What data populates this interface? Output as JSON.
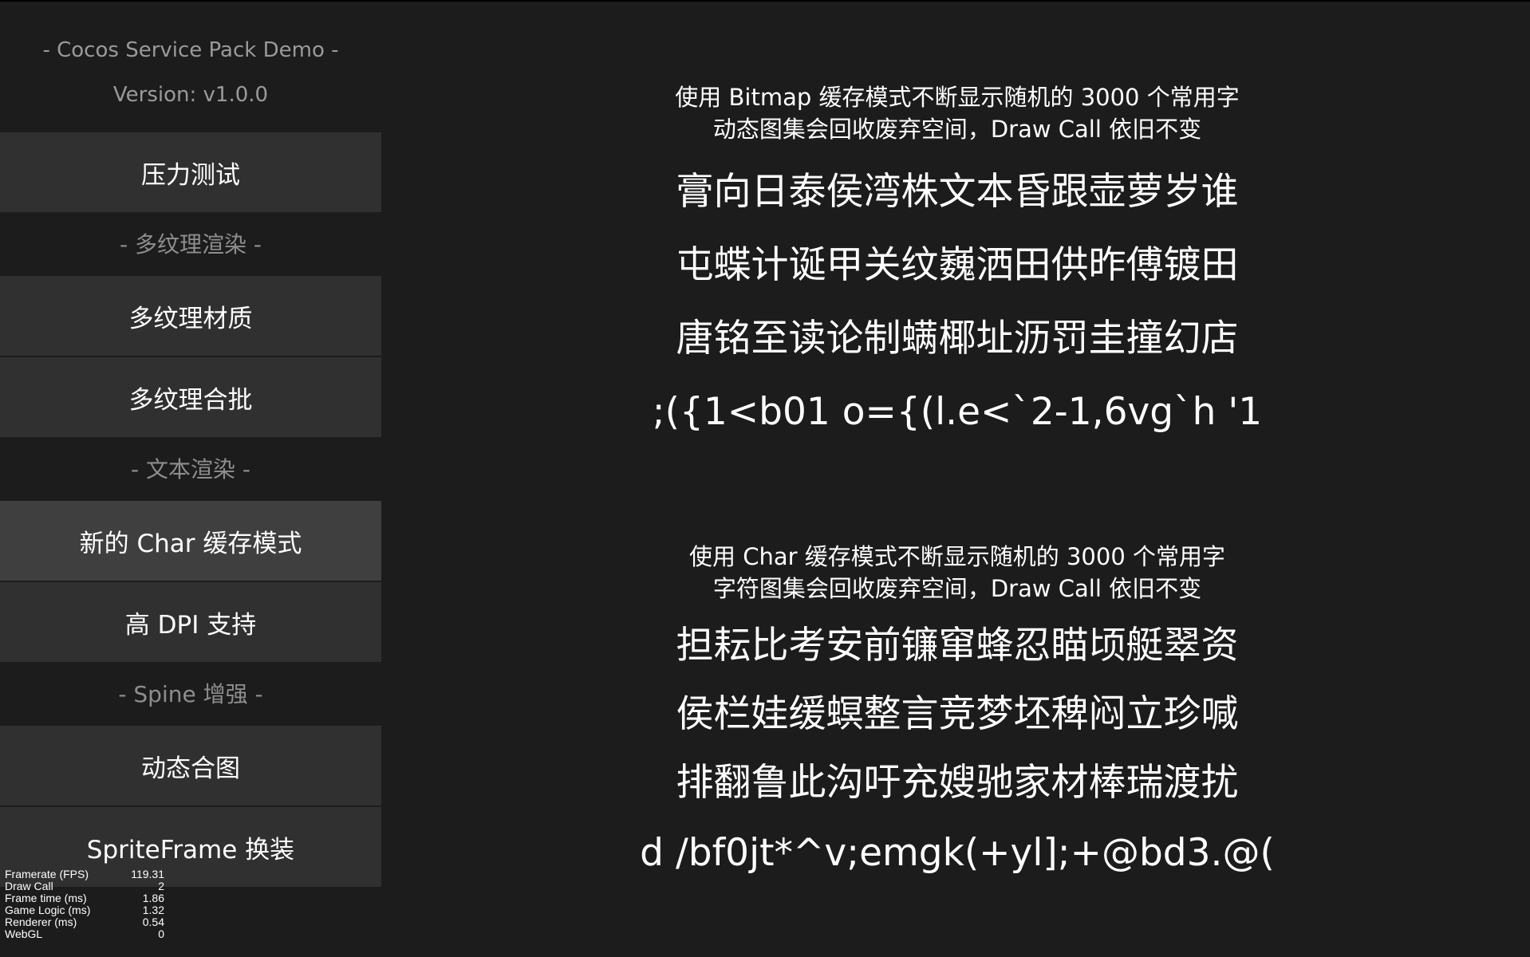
{
  "sidebar": {
    "title": "- Cocos Service Pack Demo -",
    "version": "Version: v1.0.0",
    "stress_test": "压力测试",
    "section_multitexture": "- 多纹理渲染 -",
    "multi_texture_material": "多纹理材质",
    "multi_texture_batch": "多纹理合批",
    "section_text": "- 文本渲染 -",
    "char_cache_mode": "新的 Char 缓存模式",
    "high_dpi": "高 DPI 支持",
    "section_spine": "- Spine 增强 -",
    "dynamic_atlas": "动态合图",
    "spriteframe_swap": "SpriteFrame 换装"
  },
  "stats": [
    {
      "label": "Framerate (FPS)",
      "value": "119.31"
    },
    {
      "label": "Draw Call",
      "value": "2"
    },
    {
      "label": "Frame time (ms)",
      "value": "1.86"
    },
    {
      "label": "Game Logic (ms)",
      "value": "1.32"
    },
    {
      "label": "Renderer (ms)",
      "value": "0.54"
    },
    {
      "label": "WebGL",
      "value": "0"
    }
  ],
  "bitmap_section": {
    "desc_line1": "使用 Bitmap 缓存模式不断显示随机的 3000 个常用字",
    "desc_line2": "动态图集会回收废弃空间，Draw Call 依旧不变",
    "lines": [
      "膏向日泰侯湾株文本昏跟壶萝岁谁",
      "屯蝶计诞甲关纹巍洒田供昨傅镀田",
      "唐铭至读论制螨椰址沥罚圭撞幻店",
      ";({1<b01 o={(l.e<`2-1,6vg`h '1"
    ]
  },
  "char_section": {
    "desc_line1": "使用 Char 缓存模式不断显示随机的 3000 个常用字",
    "desc_line2": "字符图集会回收废弃空间，Draw Call 依旧不变",
    "lines": [
      "担耘比考安前镰窜蜂忍瞄顷艇翠资",
      "侯栏娃缓螟整言竞梦坯稗闷立珍喊",
      "排翻鲁此沟吁充嫂驰家材棒瑞渡扰",
      "d /bf0jt*^v;emgk(+yl];+@bd3.@("
    ]
  }
}
